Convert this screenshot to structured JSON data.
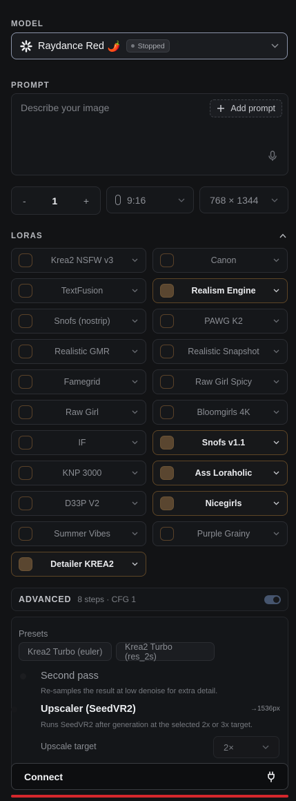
{
  "model": {
    "section_label": "MODEL",
    "name": "Raydance Red",
    "emoji": "🌶️",
    "status": "Stopped",
    "icon": "burst-icon"
  },
  "prompt": {
    "section_label": "PROMPT",
    "placeholder": "Describe your image",
    "add_label": "Add prompt",
    "mic_icon": "microphone-icon"
  },
  "generation": {
    "minus": "-",
    "count": "1",
    "plus": "+",
    "aspect_ratio": "9:16",
    "resolution": "768 × 1344"
  },
  "loras": {
    "section_label": "LORAS",
    "items": [
      {
        "label": "Krea2 NSFW v3",
        "enabled": false
      },
      {
        "label": "Canon",
        "enabled": false
      },
      {
        "label": "TextFusion",
        "enabled": false
      },
      {
        "label": "Realism Engine",
        "enabled": true
      },
      {
        "label": "Snofs (nostrip)",
        "enabled": false
      },
      {
        "label": "PAWG K2",
        "enabled": false
      },
      {
        "label": "Realistic GMR",
        "enabled": false
      },
      {
        "label": "Realistic Snapshot",
        "enabled": false
      },
      {
        "label": "Famegrid",
        "enabled": false
      },
      {
        "label": "Raw Girl Spicy",
        "enabled": false
      },
      {
        "label": "Raw Girl",
        "enabled": false
      },
      {
        "label": "Bloomgirls 4K",
        "enabled": false
      },
      {
        "label": "IF",
        "enabled": false
      },
      {
        "label": "Snofs v1.1",
        "enabled": true
      },
      {
        "label": "KNP 3000",
        "enabled": false
      },
      {
        "label": "Ass Loraholic",
        "enabled": true
      },
      {
        "label": "D33P V2",
        "enabled": false
      },
      {
        "label": "Nicegirls",
        "enabled": true
      },
      {
        "label": "Summer Vibes",
        "enabled": false
      },
      {
        "label": "Purple Grainy",
        "enabled": false
      },
      {
        "label": "Detailer KREA2",
        "enabled": true
      }
    ]
  },
  "advanced": {
    "title": "ADVANCED",
    "meta": "8 steps · CFG 1",
    "enabled": true,
    "presets_label": "Presets",
    "presets": [
      "Krea2 Turbo (euler)",
      "Krea2 Turbo (res_2s)"
    ],
    "second_pass": {
      "title": "Second pass",
      "desc": "Re-samples the result at low denoise for extra detail.",
      "enabled": false
    },
    "upscaler": {
      "title": "Upscaler (SeedVR2)",
      "desc": "Runs SeedVR2 after generation at the selected 2x or 3x target.",
      "target_px": "→1536px",
      "enabled": true,
      "target_label": "Upscale target",
      "target_value": "2×"
    }
  },
  "connect": {
    "label": "Connect",
    "icon": "plug-icon"
  },
  "colors": {
    "background": "#121315",
    "accent_lora": "#5a4630",
    "progress_bar": "#d4272c"
  }
}
